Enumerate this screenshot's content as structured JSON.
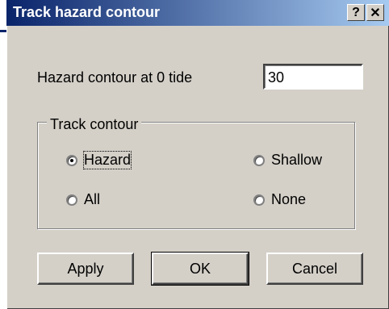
{
  "window": {
    "title": "Track hazard contour",
    "help_label": "?",
    "close_label": "✕"
  },
  "hazard": {
    "label": "Hazard contour at 0 tide",
    "value": "30"
  },
  "group": {
    "legend": "Track contour",
    "options": [
      {
        "label": "Hazard",
        "checked": true
      },
      {
        "label": "Shallow",
        "checked": false
      },
      {
        "label": "All",
        "checked": false
      },
      {
        "label": "None",
        "checked": false
      }
    ]
  },
  "buttons": {
    "apply": "Apply",
    "ok": "OK",
    "cancel": "Cancel"
  }
}
